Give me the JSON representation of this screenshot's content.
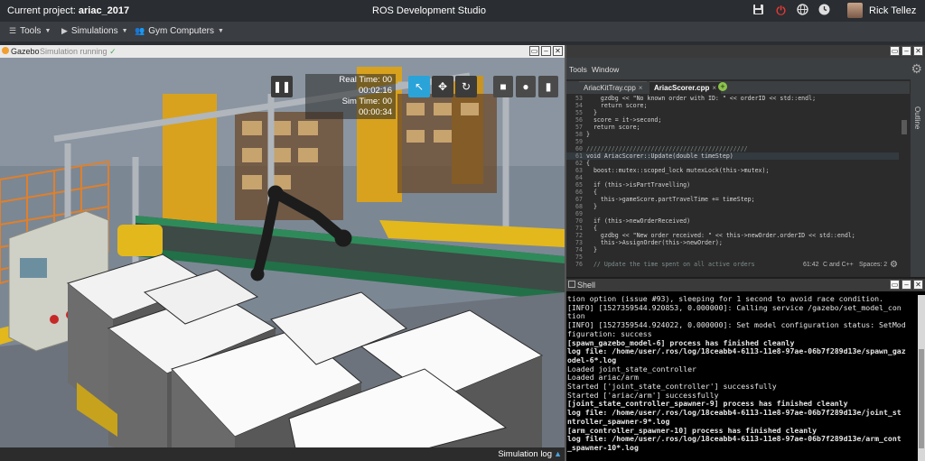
{
  "topbar": {
    "project_label": "Current project:",
    "project_name": "ariac_2017",
    "title": "ROS Development Studio",
    "user_name": "Rick Tellez",
    "icons": [
      "save-icon",
      "power-icon",
      "globe-icon",
      "clock-icon"
    ]
  },
  "menubar": {
    "items": [
      {
        "label": "Tools",
        "icon": "hamburger-icon"
      },
      {
        "label": "Simulations",
        "icon": "play-circle-icon"
      },
      {
        "label": "Gym Computers",
        "icon": "people-icon"
      }
    ]
  },
  "gazebo": {
    "title": "Gazebo",
    "status": "Simulation running",
    "real_time": "Real Time: 00 00:02:16",
    "sim_time": "Sim Time: 00 00:00:34",
    "simulation_log": "Simulation log"
  },
  "editor": {
    "menu": [
      "Tools",
      "Window"
    ],
    "tabs": [
      "AriacKitTray.cpp",
      "AriacScorer.cpp"
    ],
    "outline": "Outline",
    "cursor": "61:42",
    "language": "C and C++",
    "spaces": "Spaces: 2",
    "lines": [
      {
        "n": "53",
        "t": "    gzdbg << \"No known order with ID: \" << orderID << std::endl;"
      },
      {
        "n": "54",
        "t": "    return score;"
      },
      {
        "n": "55",
        "t": "  }"
      },
      {
        "n": "56",
        "t": "  score = it->second;"
      },
      {
        "n": "57",
        "t": "  return score;"
      },
      {
        "n": "58",
        "t": "}"
      },
      {
        "n": "59",
        "t": ""
      },
      {
        "n": "60",
        "t": "/////////////////////////////////////////////"
      },
      {
        "n": "61",
        "t": "void AriacScorer::Update(double timeStep)"
      },
      {
        "n": "62",
        "t": "{"
      },
      {
        "n": "63",
        "t": "  boost::mutex::scoped_lock mutexLock(this->mutex);"
      },
      {
        "n": "64",
        "t": ""
      },
      {
        "n": "65",
        "t": "  if (this->isPartTravelling)"
      },
      {
        "n": "66",
        "t": "  {"
      },
      {
        "n": "67",
        "t": "    this->gameScore.partTravelTime += timeStep;"
      },
      {
        "n": "68",
        "t": "  }"
      },
      {
        "n": "69",
        "t": ""
      },
      {
        "n": "70",
        "t": "  if (this->newOrderReceived)"
      },
      {
        "n": "71",
        "t": "  {"
      },
      {
        "n": "72",
        "t": "    gzdbg << \"New order received: \" << this->newOrder.orderID << std::endl;"
      },
      {
        "n": "73",
        "t": "    this->AssignOrder(this->newOrder);"
      },
      {
        "n": "74",
        "t": "  }"
      },
      {
        "n": "75",
        "t": ""
      },
      {
        "n": "76",
        "t": "  // Update the time spent on all active orders"
      }
    ]
  },
  "shell": {
    "title": "Shell",
    "lines": [
      {
        "t": "tion option (issue #93), sleeping for 1 second to avoid race condition.",
        "b": false
      },
      {
        "t": "[INFO] [1527359544.920853, 0.000000]: Calling service /gazebo/set_model_con",
        "b": false
      },
      {
        "t": "tion",
        "b": false
      },
      {
        "t": "[INFO] [1527359544.924022, 0.000000]: Set model configuration status: SetMod",
        "b": false
      },
      {
        "t": "figuration: success",
        "b": false
      },
      {
        "t": "[spawn_gazebo_model-6] process has finished cleanly",
        "b": true
      },
      {
        "t": "log file: /home/user/.ros/log/18ceabb4-6113-11e8-97ae-06b7f289d13e/spawn_gaz",
        "b": true
      },
      {
        "t": "odel-6*.log",
        "b": true
      },
      {
        "t": "Loaded joint_state_controller",
        "b": false
      },
      {
        "t": "Loaded ariac/arm",
        "b": false
      },
      {
        "t": "Started ['joint_state_controller'] successfully",
        "b": false
      },
      {
        "t": "Started ['ariac/arm'] successfully",
        "b": false
      },
      {
        "t": "[joint_state_controller_spawner-9] process has finished cleanly",
        "b": true
      },
      {
        "t": "log file: /home/user/.ros/log/18ceabb4-6113-11e8-97ae-06b7f289d13e/joint_st",
        "b": true
      },
      {
        "t": "ntroller_spawner-9*.log",
        "b": true
      },
      {
        "t": "[arm_controller_spawner-10] process has finished cleanly",
        "b": true
      },
      {
        "t": "log file: /home/user/.ros/log/18ceabb4-6113-11e8-97ae-06b7f289d13e/arm_cont",
        "b": true
      },
      {
        "t": "_spawner-10*.log",
        "b": true
      }
    ]
  }
}
